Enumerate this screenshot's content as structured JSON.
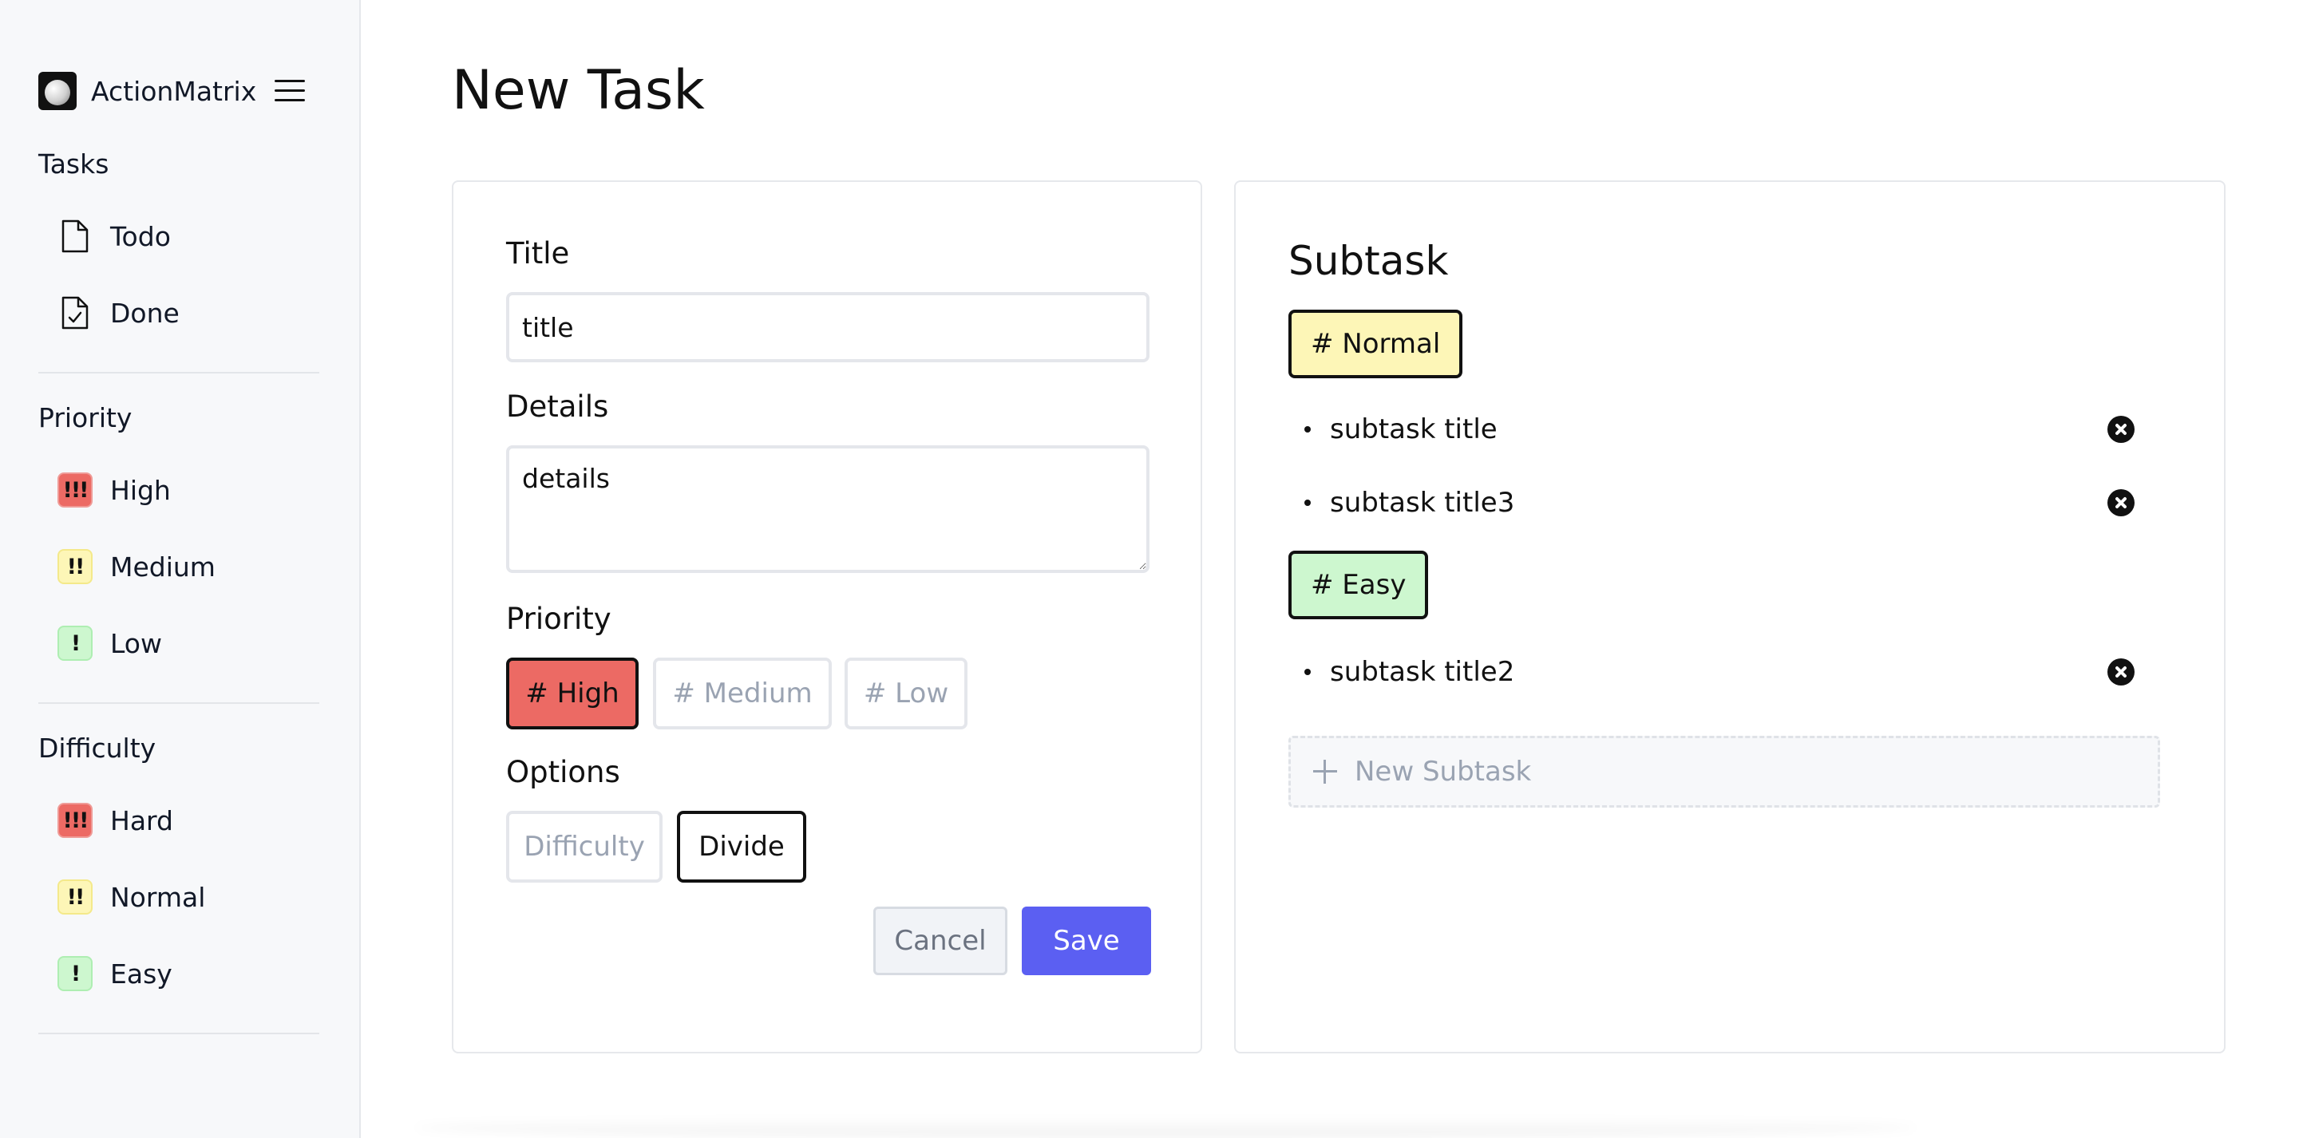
{
  "app": {
    "name": "ActionMatrix"
  },
  "sidebar": {
    "sections": [
      {
        "title": "Tasks",
        "items": [
          {
            "label": "Todo",
            "icon": "document-icon"
          },
          {
            "label": "Done",
            "icon": "document-check-icon"
          }
        ]
      },
      {
        "title": "Priority",
        "items": [
          {
            "label": "High",
            "badge": "!!!",
            "color": "#ec6a64"
          },
          {
            "label": "Medium",
            "badge": "!!",
            "color": "#fdf6b7"
          },
          {
            "label": "Low",
            "badge": "!",
            "color": "#cdf7cf"
          }
        ]
      },
      {
        "title": "Difficulty",
        "items": [
          {
            "label": "Hard",
            "badge": "!!!",
            "color": "#ec6a64"
          },
          {
            "label": "Normal",
            "badge": "!!",
            "color": "#fdf6b7"
          },
          {
            "label": "Easy",
            "badge": "!",
            "color": "#cdf7cf"
          }
        ]
      }
    ]
  },
  "page": {
    "title": "New Task"
  },
  "form": {
    "title_label": "Title",
    "title_value": "title",
    "details_label": "Details",
    "details_value": "details",
    "priority_label": "Priority",
    "priority_options": [
      "# High",
      "# Medium",
      "# Low"
    ],
    "priority_selected": "# High",
    "options_label": "Options",
    "options": [
      "Difficulty",
      "Divide"
    ],
    "options_selected": "Divide",
    "cancel_label": "Cancel",
    "save_label": "Save",
    "accent_color": "#5b5ff2"
  },
  "subtasks": {
    "heading": "Subtask",
    "groups": [
      {
        "tag": "# Normal",
        "color": "#fdf6b7",
        "items": [
          "subtask title",
          "subtask title3"
        ]
      },
      {
        "tag": "# Easy",
        "color": "#cdf7cf",
        "items": [
          "subtask title2"
        ]
      }
    ],
    "new_label": "New Subtask"
  }
}
